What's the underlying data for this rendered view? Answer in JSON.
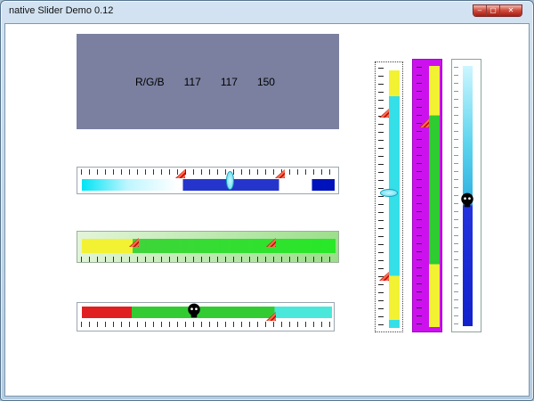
{
  "window": {
    "title": "native Slider Demo 0.12",
    "buttons": {
      "minimize": "–",
      "maximize": "▢",
      "close": "✕"
    }
  },
  "rgb_panel": {
    "label": "R/G/B",
    "red": "117",
    "green": "117",
    "blue": "150"
  },
  "colors": {
    "panel-bg": "#7b80a0",
    "blue-fill": "#2535cc",
    "blue-end": "#0012bb",
    "blue-track": "#2233dd",
    "cyan": "#35dfe8",
    "cyan-lt": "#49e8da",
    "yellow": "#f2f233",
    "green": "#28e828",
    "green2": "#2ecc30",
    "red": "#e02020",
    "magenta": "#cc11ee",
    "marker-red": "#c41212"
  }
}
